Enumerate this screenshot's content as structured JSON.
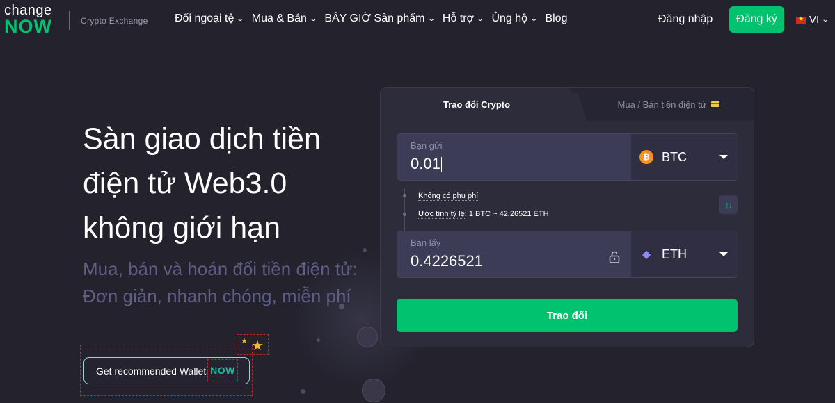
{
  "brand": {
    "logo_top": "change",
    "logo_bottom": "NOW",
    "tagline": "Crypto Exchange"
  },
  "nav": {
    "items": [
      {
        "label": "Đổi ngoại tệ",
        "has_dropdown": true
      },
      {
        "label": "Mua & Bán",
        "has_dropdown": true
      },
      {
        "label": "BÂY GIỜ Sản phẩm",
        "has_dropdown": true
      },
      {
        "label": "Hỗ trợ",
        "has_dropdown": true
      },
      {
        "label": "Ủng hộ",
        "has_dropdown": true
      },
      {
        "label": "Blog",
        "has_dropdown": false
      }
    ],
    "login_label": "Đăng nhập",
    "signup_label": "Đăng ký",
    "language": "VI"
  },
  "hero": {
    "title": "Sàn giao dịch tiền điện tử Web3.0 không giới hạn",
    "subtitle_line1": "Mua, bán và hoán đổi tiền điện tử:",
    "subtitle_line2": "Đơn giản, nhanh chóng, miễn phí",
    "wallet_button_label": "Get recommended Wallet",
    "wallet_badge": "NOW"
  },
  "widget": {
    "tab_active": "Trao đổi Crypto",
    "tab_inactive": "Mua / Bán tiền điện tử",
    "send": {
      "label": "Bạn gửi",
      "value": "0.01",
      "currency": "BTC",
      "icon": "bitcoin-icon"
    },
    "no_fee": "Không có phụ phí",
    "rate_label": "Ước tính tỷ lệ",
    "rate_value": ": 1 BTC ~ 42.26521 ETH",
    "receive": {
      "label": "Bạn lấy",
      "value": "0.4226521",
      "currency": "ETH",
      "icon": "ethereum-icon"
    },
    "exchange_button": "Trao đổi"
  },
  "colors": {
    "background": "#23222d",
    "accent": "#00c26f",
    "panel": "#2d2c3b",
    "field": "#3d3c57",
    "subtitle": "#5f5d84"
  }
}
